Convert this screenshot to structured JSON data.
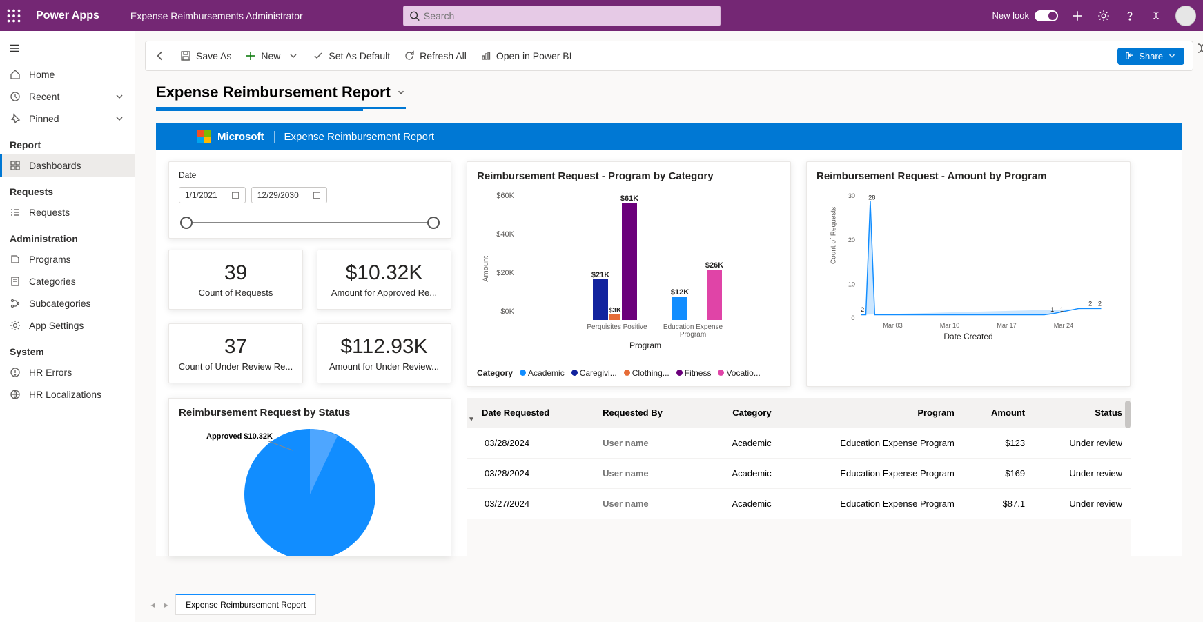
{
  "topbar": {
    "app_name": "Power Apps",
    "app_label": "Expense Reimbursements Administrator",
    "search_placeholder": "Search",
    "new_look": "New look"
  },
  "sidebar": {
    "home": "Home",
    "recent": "Recent",
    "pinned": "Pinned",
    "report_head": "Report",
    "dashboards": "Dashboards",
    "requests_head": "Requests",
    "requests": "Requests",
    "admin_head": "Administration",
    "programs": "Programs",
    "categories": "Categories",
    "subcategories": "Subcategories",
    "app_settings": "App Settings",
    "system_head": "System",
    "hr_errors": "HR Errors",
    "hr_local": "HR Localizations"
  },
  "cmdbar": {
    "save_as": "Save As",
    "new": "New",
    "set_default": "Set As Default",
    "refresh": "Refresh All",
    "open_pbi": "Open in Power BI",
    "share": "Share"
  },
  "report": {
    "title": "Expense Reimbursement Report",
    "band_brand": "Microsoft",
    "band_title": "Expense Reimbursement Report",
    "date_label": "Date",
    "date_from": "1/1/2021",
    "date_to": "12/29/2030",
    "kpi1_val": "39",
    "kpi1_lbl": "Count of Requests",
    "kpi2_val": "$10.32K",
    "kpi2_lbl": "Amount for Approved Re...",
    "kpi3_val": "37",
    "kpi3_lbl": "Count of Under Review Re...",
    "kpi4_val": "$112.93K",
    "kpi4_lbl": "Amount for Under Review...",
    "bar_title": "Reimbursement Request - Program by Category",
    "bar_ylabel": "Amount",
    "bar_xlabel": "Program",
    "bar_legend_label": "Category",
    "line_title": "Reimbursement Request - Amount by Program",
    "line_ylabel": "Count of Requests",
    "line_xlabel": "Date Created",
    "pie_title": "Reimbursement Request by Status",
    "pie_label": "Approved $10.32K",
    "tab_name": "Expense Reimbursement Report"
  },
  "table": {
    "cols": {
      "date": "Date Requested",
      "by": "Requested By",
      "cat": "Category",
      "prog": "Program",
      "amt": "Amount",
      "status": "Status"
    },
    "rows": [
      {
        "date": "03/28/2024",
        "by": "User name",
        "cat": "Academic",
        "prog": "Education Expense Program",
        "amt": "$123",
        "status": "Under review"
      },
      {
        "date": "03/28/2024",
        "by": "User name",
        "cat": "Academic",
        "prog": "Education Expense Program",
        "amt": "$169",
        "status": "Under review"
      },
      {
        "date": "03/27/2024",
        "by": "User name",
        "cat": "Academic",
        "prog": "Education Expense Program",
        "amt": "$87.1",
        "status": "Under review"
      }
    ]
  },
  "chart_data": [
    {
      "type": "bar",
      "title": "Reimbursement Request - Program by Category",
      "xlabel": "Program",
      "ylabel": "Amount",
      "ylim": [
        0,
        65000
      ],
      "categories": [
        "Perquisites Positive",
        "Education Expense Program"
      ],
      "series": [
        {
          "name": "Academic",
          "color": "#118dff",
          "values": [
            null,
            12000
          ]
        },
        {
          "name": "Caregivi...",
          "color": "#12239e",
          "values": [
            21000,
            null
          ]
        },
        {
          "name": "Clothing...",
          "color": "#e66c37",
          "values": [
            3000,
            null
          ]
        },
        {
          "name": "Fitness",
          "color": "#6b007b",
          "values": [
            61000,
            null
          ]
        },
        {
          "name": "Vocatio...",
          "color": "#e044a7",
          "values": [
            null,
            26000
          ]
        }
      ],
      "bar_labels": [
        "$21K",
        "$3K",
        "$61K",
        "$12K",
        "$26K"
      ]
    },
    {
      "type": "area",
      "title": "Reimbursement Request - Amount by Program",
      "xlabel": "Date Created",
      "ylabel": "Count of Requests",
      "ylim": [
        0,
        30
      ],
      "x_ticks": [
        "Mar 03",
        "Mar 10",
        "Mar 17",
        "Mar 24"
      ],
      "points": [
        {
          "x": "Mar 01",
          "y": 2
        },
        {
          "x": "Mar 02",
          "y": 28
        },
        {
          "x": "Mar 03",
          "y": 1
        },
        {
          "x": "Mar 22",
          "y": 1
        },
        {
          "x": "Mar 23",
          "y": 1
        },
        {
          "x": "Mar 25",
          "y": 2
        },
        {
          "x": "Mar 26",
          "y": 2
        }
      ]
    },
    {
      "type": "pie",
      "title": "Reimbursement Request by Status",
      "slices": [
        {
          "name": "Approved",
          "value": 10320,
          "label": "Approved $10.32K",
          "color": "#4ea6ff"
        },
        {
          "name": "Under Review",
          "value": 112930,
          "color": "#118dff"
        }
      ]
    }
  ]
}
